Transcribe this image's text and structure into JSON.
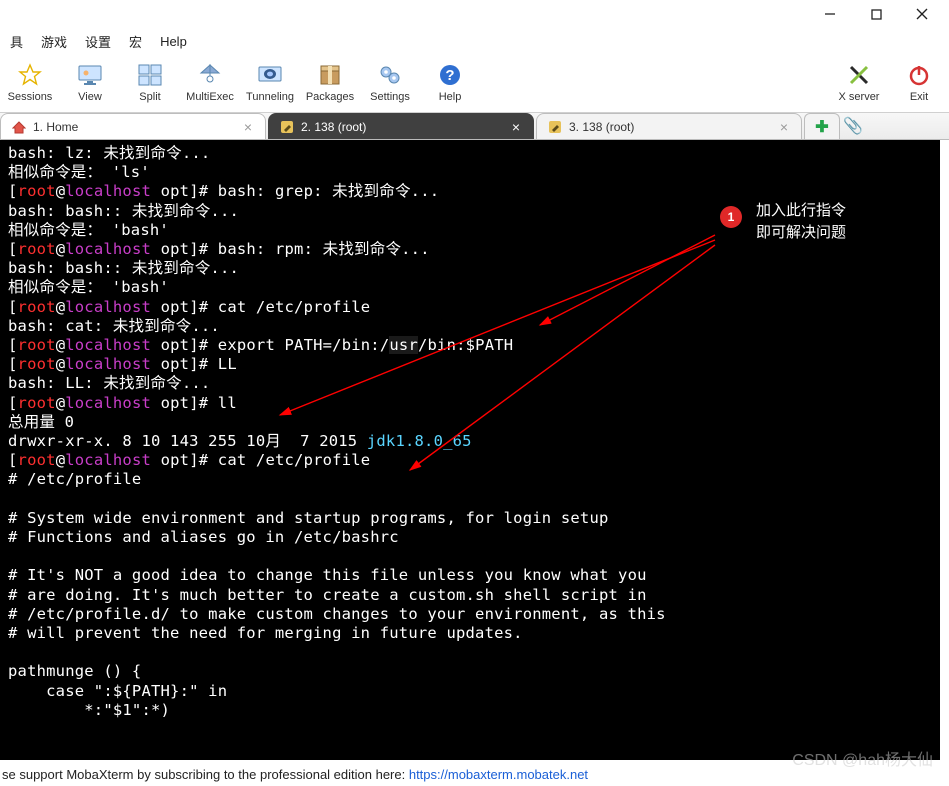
{
  "title_buttons": {
    "minimize": "—",
    "maximize": "☐",
    "close": "✕"
  },
  "menu": {
    "items": [
      "具",
      "游戏",
      "设置",
      "宏",
      "Help"
    ]
  },
  "toolbar": {
    "sessions": "Sessions",
    "view": "View",
    "split": "Split",
    "multiexec": "MultiExec",
    "tunneling": "Tunneling",
    "packages": "Packages",
    "settings": "Settings",
    "help": "Help",
    "xserver": "X server",
    "exit": "Exit"
  },
  "tabs": {
    "home": "1. Home",
    "active": "2. 138 (root)",
    "third": "3. 138 (root)",
    "addtab_glyph": "✚",
    "clip_glyph": "📎"
  },
  "terminal": {
    "l01a": "bash: lz: 未找到命令...",
    "l02a": "相似命令是： 'ls'",
    "l03_user": "root",
    "l03_host": "localhost",
    "l03_path": "opt",
    "l03_cmd": "bash: grep: 未找到命令...",
    "l04a": "bash: bash:: 未找到命令...",
    "l05a": "相似命令是： 'bash'",
    "l06_cmd": "bash: rpm: 未找到命令...",
    "l07a": "bash: bash:: 未找到命令...",
    "l08a": "相似命令是： 'bash'",
    "l09_cmd": "cat /etc/profile",
    "l10a": "bash: cat: 未找到命令...",
    "l11_cmd_a": "export PATH=/bin:/",
    "l11_cmd_b": "usr",
    "l11_cmd_c": "/bin:$PATH",
    "l12_cmd": "LL",
    "l13a": "bash: LL: 未找到命令...",
    "l14_cmd": "ll",
    "l15a": "总用量 0",
    "l16_perm": "drwxr-xr-x.",
    "l16_rest": " 8 10 143 255 10月  7 2015 ",
    "l16_link": "jdk1.8.0_65",
    "l17_cmd": "cat /etc/profile",
    "l18a": "# /etc/profile",
    "l19a": "",
    "l20a": "# System wide environment and startup programs, for login setup",
    "l21a": "# Functions and aliases go in /etc/bashrc",
    "l22a": "",
    "l23a": "# It's NOT a good idea to change this file unless you know what you",
    "l24a": "# are doing. It's much better to create a custom.sh shell script in",
    "l25a": "# /etc/profile.d/ to make custom changes to your environment, as this",
    "l26a": "# will prevent the need for merging in future updates.",
    "l27a": "",
    "l28a": "pathmunge () {",
    "l29a": "    case \":${PATH}:\" in",
    "l30a": "        *:\"$1\":*)"
  },
  "annotation": {
    "badge": "1",
    "line1": "加入此行指令",
    "line2": "即可解决问题"
  },
  "footer": {
    "text_prefix": "se support MobaXterm by subscribing to the professional edition here:  ",
    "link_text": "https://mobaxterm.mobatek.net"
  },
  "watermark": "CSDN @hah杨大仙"
}
